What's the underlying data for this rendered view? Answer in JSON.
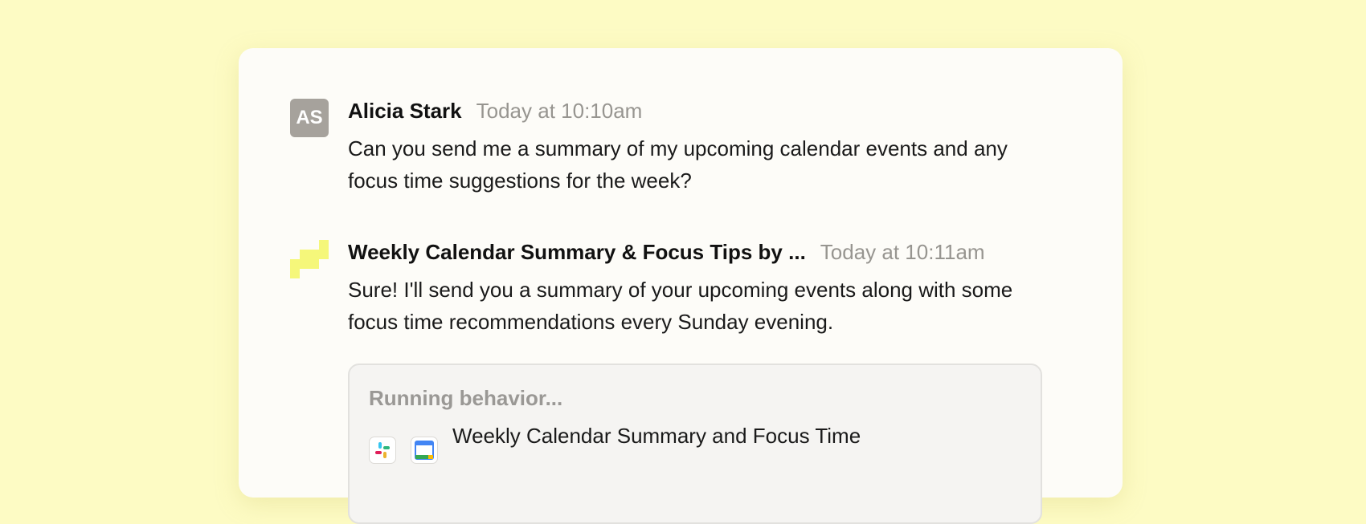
{
  "messages": [
    {
      "avatar_initials": "AS",
      "author": "Alicia Stark",
      "time": "Today at 10:10am",
      "text": "Can you send me a summary of my upcoming calendar events and any focus time suggestions for the week?"
    },
    {
      "author": "Weekly Calendar Summary & Focus Tips by ...",
      "time": "Today at 10:11am",
      "text": "Sure! I'll send you a summary of your upcoming events along with some focus time recommendations every Sunday evening."
    }
  ],
  "behavior": {
    "status": "Running behavior...",
    "title": "Weekly Calendar Summary and Focus Time",
    "app_icons": [
      "slack-icon",
      "google-calendar-icon"
    ]
  },
  "colors": {
    "background": "#fdfbc4",
    "bot_logo": "#f5f77a",
    "avatar": "#a6a29c"
  }
}
